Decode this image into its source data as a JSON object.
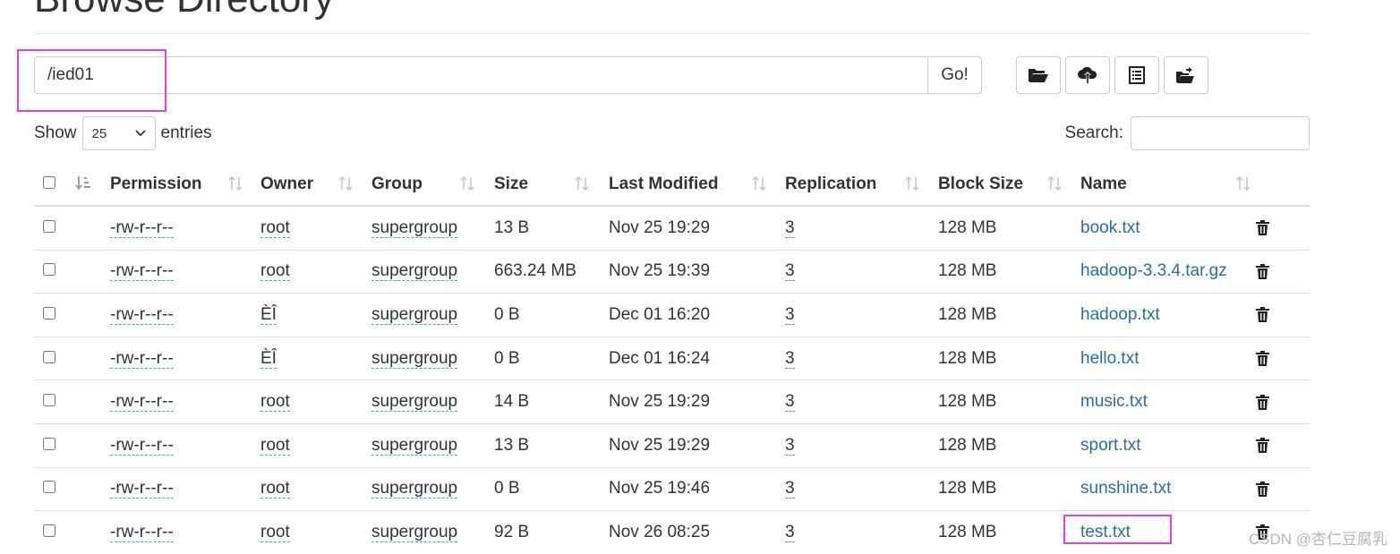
{
  "page": {
    "title": "Browse Directory"
  },
  "path_bar": {
    "value": "/ied01",
    "go_label": "Go!"
  },
  "toolbar": {
    "buttons": [
      {
        "name": "create-directory-button",
        "icon": "folder-open-icon"
      },
      {
        "name": "upload-button",
        "icon": "cloud-upload-icon"
      },
      {
        "name": "view-list-button",
        "icon": "list-alt-icon"
      },
      {
        "name": "cut-paste-button",
        "icon": "folder-move-icon"
      }
    ]
  },
  "list_controls": {
    "show_label": "Show",
    "page_size": "25",
    "entries_label": "entries",
    "search_label": "Search:"
  },
  "table": {
    "columns": [
      "Permission",
      "Owner",
      "Group",
      "Size",
      "Last Modified",
      "Replication",
      "Block Size",
      "Name"
    ],
    "rows": [
      {
        "permission": "-rw-r--r--",
        "owner": "root",
        "group": "supergroup",
        "size": "13 B",
        "modified": "Nov 25 19:29",
        "replication": "3",
        "block_size": "128 MB",
        "name": "book.txt"
      },
      {
        "permission": "-rw-r--r--",
        "owner": "root",
        "group": "supergroup",
        "size": "663.24 MB",
        "modified": "Nov 25 19:39",
        "replication": "3",
        "block_size": "128 MB",
        "name": "hadoop-3.3.4.tar.gz"
      },
      {
        "permission": "-rw-r--r--",
        "owner": "ÈÎ",
        "group": "supergroup",
        "size": "0 B",
        "modified": "Dec 01 16:20",
        "replication": "3",
        "block_size": "128 MB",
        "name": "hadoop.txt"
      },
      {
        "permission": "-rw-r--r--",
        "owner": "ÈÎ",
        "group": "supergroup",
        "size": "0 B",
        "modified": "Dec 01 16:24",
        "replication": "3",
        "block_size": "128 MB",
        "name": "hello.txt"
      },
      {
        "permission": "-rw-r--r--",
        "owner": "root",
        "group": "supergroup",
        "size": "14 B",
        "modified": "Nov 25 19:29",
        "replication": "3",
        "block_size": "128 MB",
        "name": "music.txt"
      },
      {
        "permission": "-rw-r--r--",
        "owner": "root",
        "group": "supergroup",
        "size": "13 B",
        "modified": "Nov 25 19:29",
        "replication": "3",
        "block_size": "128 MB",
        "name": "sport.txt"
      },
      {
        "permission": "-rw-r--r--",
        "owner": "root",
        "group": "supergroup",
        "size": "0 B",
        "modified": "Nov 25 19:46",
        "replication": "3",
        "block_size": "128 MB",
        "name": "sunshine.txt"
      },
      {
        "permission": "-rw-r--r--",
        "owner": "root",
        "group": "supergroup",
        "size": "92 B",
        "modified": "Nov 26 08:25",
        "replication": "3",
        "block_size": "128 MB",
        "name": "test.txt"
      }
    ]
  },
  "watermark": "CSDN @杏仁豆腐乳",
  "colors": {
    "link": "#2e6da4",
    "highlight": "#e040e6",
    "border": "#cccccc"
  }
}
